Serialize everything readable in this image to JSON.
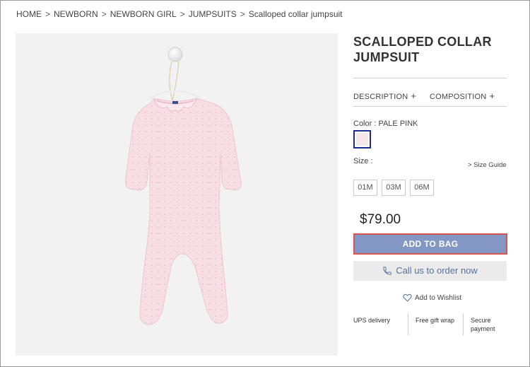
{
  "breadcrumb": {
    "items": [
      "HOME",
      "NEWBORN",
      "NEWBORN GIRL",
      "JUMPSUITS",
      "Scalloped collar jumpsuit"
    ],
    "separator": ">"
  },
  "product": {
    "title": "SCALLOPED COLLAR JUMPSUIT",
    "tabs": {
      "description": "DESCRIPTION",
      "composition": "COMPOSITION",
      "plus": "+"
    },
    "color_label": "Color : PALE PINK",
    "swatch_color": "#f3e7ea",
    "size_label": "Size :",
    "size_guide": "> Size Guide",
    "sizes": [
      "01M",
      "03M",
      "06M"
    ],
    "price": "$79.00",
    "add_to_bag": "ADD TO BAG",
    "call_label": "Call us to order now",
    "wishlist": "Add to Wishlist",
    "features": {
      "delivery": "UPS delivery",
      "gift": "Free gift wrap",
      "payment_1": "Secure",
      "payment_2": "payment"
    }
  },
  "colors": {
    "accent_button": "#8496c3",
    "call_text": "#5573a0",
    "swatch_border": "#1c2a8c",
    "highlight_border": "#d9534f"
  }
}
